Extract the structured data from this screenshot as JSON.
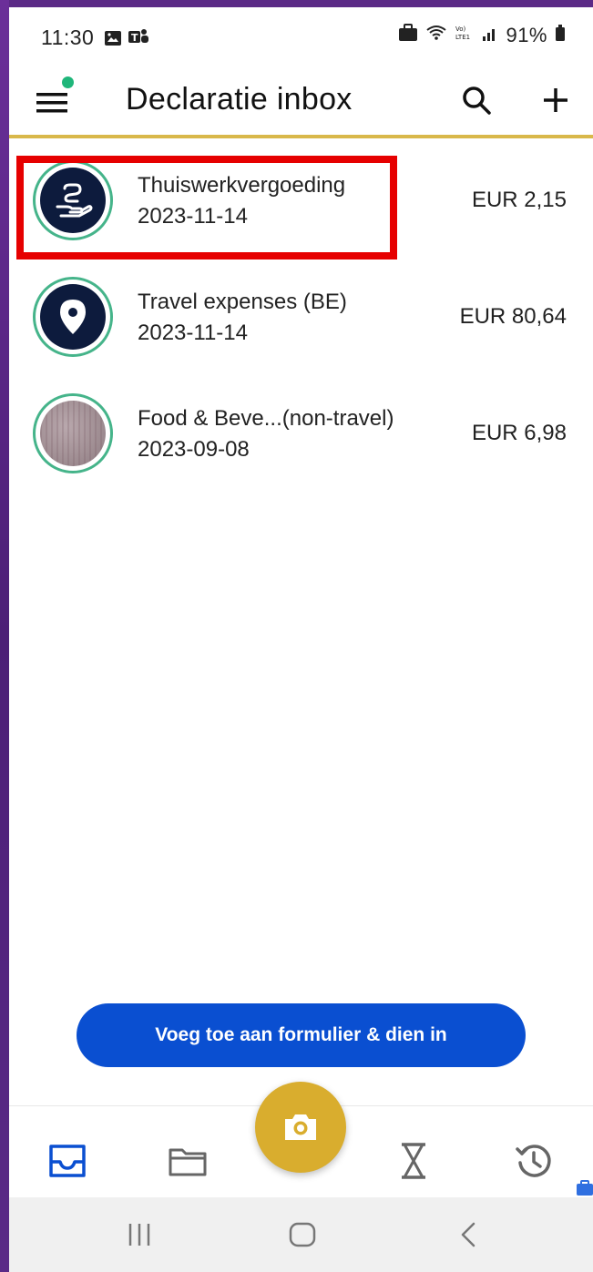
{
  "status_bar": {
    "time": "11:30",
    "battery_text": "91%",
    "icons": [
      "gallery-icon",
      "teams-icon",
      "briefcase-icon",
      "wifi-icon",
      "volte-icon",
      "signal-icon",
      "battery-icon"
    ]
  },
  "app_bar": {
    "title": "Declaratie inbox",
    "icons": [
      "menu-icon",
      "search-icon",
      "add-icon"
    ],
    "notification_dot_color": "#1fb67a",
    "accent_color": "#d9b84a"
  },
  "list": {
    "items": [
      {
        "title": "Thuiswerkvergoeding",
        "date": "2023-11-14",
        "amount": "EUR 2,15",
        "icon": "hand-money-icon",
        "highlighted": true
      },
      {
        "title": "Travel expenses (BE)",
        "date": "2023-11-14",
        "amount": "EUR 80,64",
        "icon": "location-pin-icon",
        "highlighted": false
      },
      {
        "title": "Food & Beve...(non-travel)",
        "date": "2023-09-08",
        "amount": "EUR 6,98",
        "icon": "receipt-photo",
        "highlighted": false
      }
    ]
  },
  "submit_button": {
    "label": "Voeg toe aan formulier & dien in",
    "color": "#0a4fd1"
  },
  "bottom_nav": {
    "items": [
      {
        "name": "inbox",
        "icon": "inbox-icon",
        "active": true
      },
      {
        "name": "folder",
        "icon": "folder-icon",
        "active": false
      },
      {
        "name": "camera",
        "icon": "camera-icon",
        "active": false
      },
      {
        "name": "pending",
        "icon": "hourglass-icon",
        "active": false
      },
      {
        "name": "history",
        "icon": "history-icon",
        "active": false
      }
    ],
    "active_color": "#0a4fd1",
    "fab_color": "#d9ad2e"
  },
  "system_nav": {
    "icons": [
      "recents-icon",
      "home-icon",
      "back-icon"
    ]
  }
}
